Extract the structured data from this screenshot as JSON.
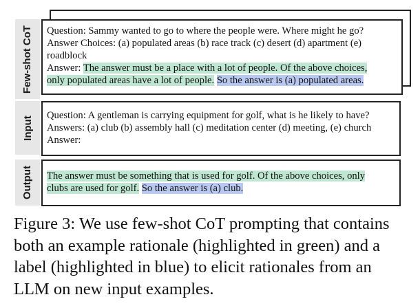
{
  "labels": {
    "few_shot": "Few-shot CoT",
    "input": "Input",
    "output": "Output"
  },
  "few_shot": {
    "question": "Question: Sammy wanted to go to where the people were. Where might he go?",
    "choices_1": "Answer Choices: (a) populated areas (b) race track (c) desert (d) apartment (e)",
    "choices_2": "roadblock",
    "answer_prefix": "Answer: ",
    "rationale_1": "The answer must be a place with a lot of people. Of the above choices,",
    "rationale_2": "only populated areas have a lot of people.",
    "label": "So the answer is (a) populated areas."
  },
  "input": {
    "question": "Question: A gentleman is carrying equipment for golf, what is he likely to have?",
    "answers": "Answers: (a) club (b) assembly hall (c) meditation center (d) meeting, (e) church",
    "answer": "Answer:"
  },
  "output": {
    "rationale_1": "The answer must be something that is used for golf. Of the above choices, only",
    "rationale_2": "clubs are used for golf.",
    "label": "So the answer is (a) club."
  },
  "caption": {
    "line_1": "Figure 3: We use few-shot CoT prompting that contains",
    "line_2": "both an example rationale (highlighted in green) and a",
    "line_3": "label (highlighted in blue) to elicit rationales from an",
    "line_4": "LLM on new input examples."
  },
  "colors": {
    "rationale_highlight": "#bfe6d2",
    "label_highlight": "#b9c8f0",
    "side_label_bg": "#e7e7e7"
  }
}
